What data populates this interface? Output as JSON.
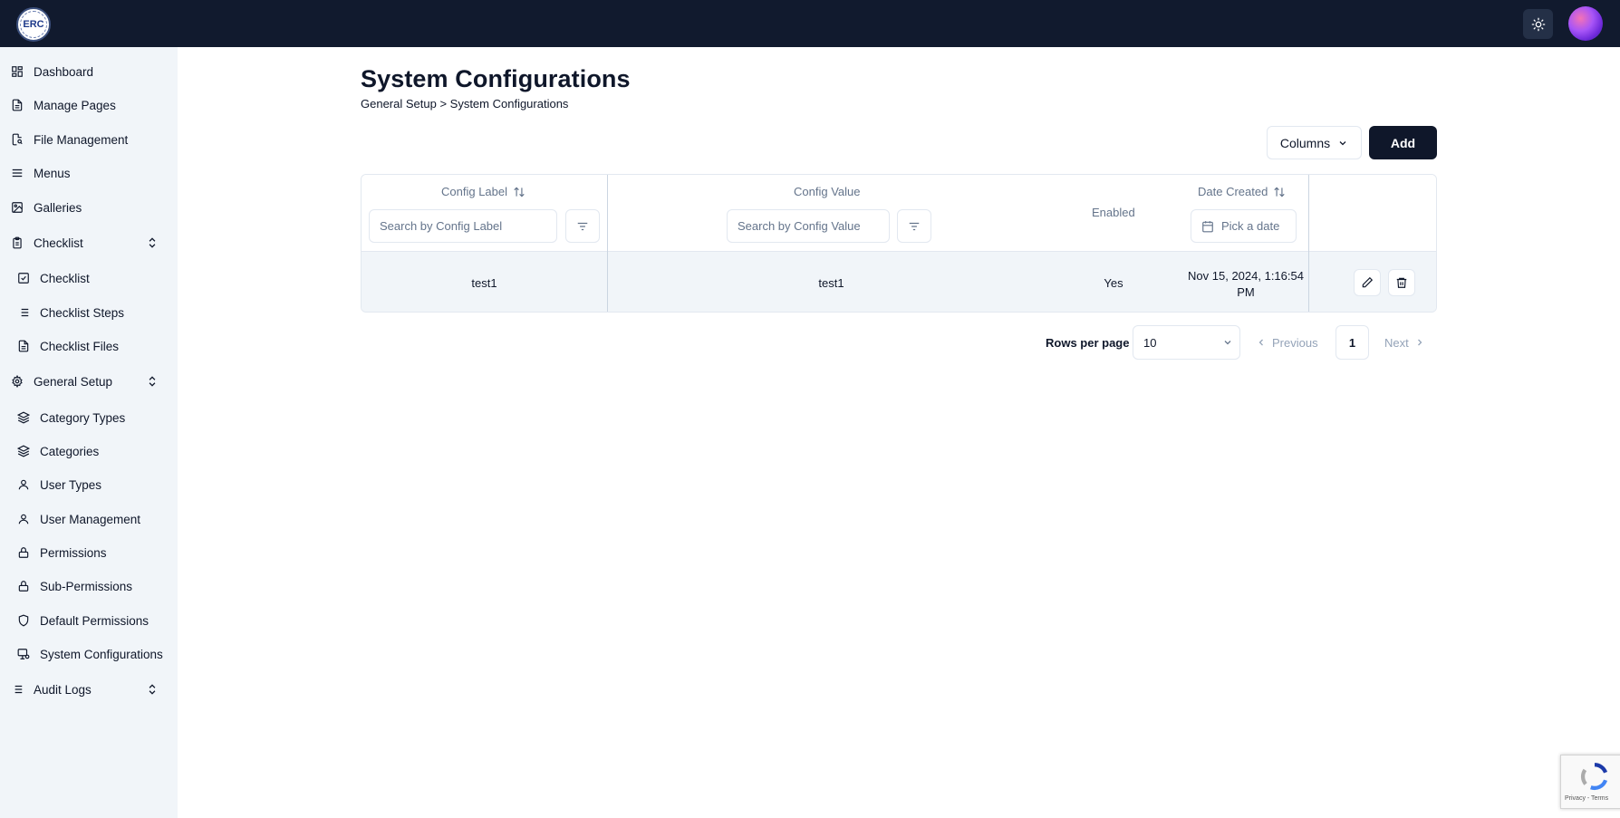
{
  "sidebar": {
    "items": [
      {
        "label": "Dashboard",
        "icon": "dashboard-icon"
      },
      {
        "label": "Manage Pages",
        "icon": "file-text-icon"
      },
      {
        "label": "File Management",
        "icon": "file-search-icon"
      },
      {
        "label": "Menus",
        "icon": "menu-icon"
      },
      {
        "label": "Galleries",
        "icon": "image-icon"
      },
      {
        "label": "Checklist",
        "icon": "clipboard-icon"
      },
      {
        "label": "Checklist",
        "icon": "check-square-icon"
      },
      {
        "label": "Checklist Steps",
        "icon": "list-icon"
      },
      {
        "label": "Checklist Files",
        "icon": "file-icon"
      },
      {
        "label": "General Setup",
        "icon": "gear-icon"
      },
      {
        "label": "Category Types",
        "icon": "layers-icon"
      },
      {
        "label": "Categories",
        "icon": "layers-icon"
      },
      {
        "label": "User Types",
        "icon": "user-icon"
      },
      {
        "label": "User Management",
        "icon": "user-icon"
      },
      {
        "label": "Permissions",
        "icon": "lock-icon"
      },
      {
        "label": "Sub-Permissions",
        "icon": "lock-icon"
      },
      {
        "label": "Default Permissions",
        "icon": "shield-icon"
      },
      {
        "label": "System Configurations",
        "icon": "monitor-gear-icon"
      },
      {
        "label": "Audit Logs",
        "icon": "list-icon"
      }
    ]
  },
  "header": {
    "logo_text": "ERC",
    "title": "System Configurations",
    "breadcrumb": "General Setup > System Configurations"
  },
  "toolbar": {
    "columns_label": "Columns",
    "add_label": "Add"
  },
  "table": {
    "headers": {
      "config_label": "Config Label",
      "config_value": "Config Value",
      "enabled": "Enabled",
      "date_created": "Date Created"
    },
    "filters": {
      "config_label_placeholder": "Search by Config Label",
      "config_value_placeholder": "Search by Config Value",
      "date_placeholder": "Pick a date"
    },
    "rows": [
      {
        "config_label": "test1",
        "config_value": "test1",
        "enabled": "Yes",
        "date_line1": "Nov 15, 2024, 1:16:54",
        "date_line2": "PM"
      }
    ]
  },
  "pagination": {
    "rows_per_page_label": "Rows per page",
    "rows_per_page_value": "10",
    "previous_label": "Previous",
    "current_page": "1",
    "next_label": "Next"
  },
  "recaptcha": {
    "footer_text": "Privacy - Terms"
  }
}
